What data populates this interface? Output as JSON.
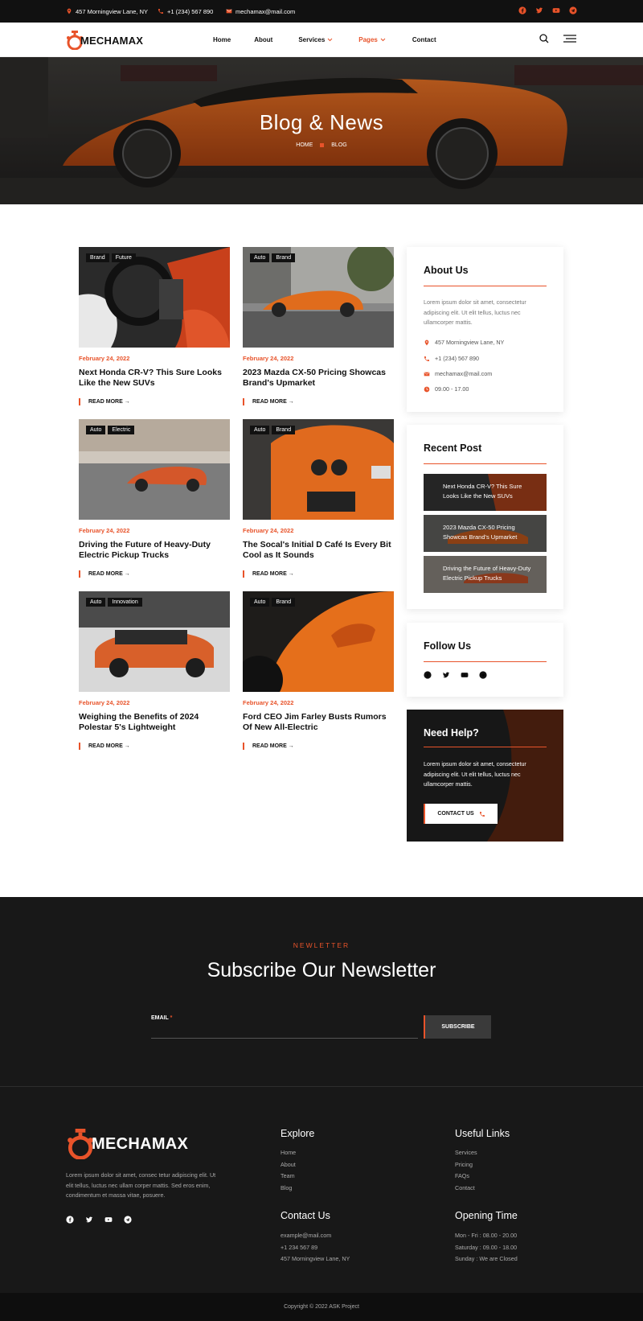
{
  "topbar": {
    "address": "457 Morningview Lane, NY",
    "phone": "+1 (234) 567 890",
    "email": "mechamax@mail.com"
  },
  "brand": {
    "name": "MECHAMAX"
  },
  "nav": {
    "items": [
      {
        "label": "Home"
      },
      {
        "label": "About"
      },
      {
        "label": "Services"
      },
      {
        "label": "Pages"
      },
      {
        "label": "Contact"
      }
    ]
  },
  "hero": {
    "title": "Blog & News",
    "crumb_home": "HOME",
    "crumb_current": "BLOG"
  },
  "posts": [
    {
      "tags": [
        "Brand",
        "Future"
      ],
      "date": "February 24, 2022",
      "title": "Next Honda CR-V? This Sure Looks Like the New SUVs",
      "more": "READ MORE"
    },
    {
      "tags": [
        "Auto",
        "Brand"
      ],
      "date": "February 24, 2022",
      "title": "2023 Mazda CX-50 Pricing Showcas Brand's Upmarket",
      "more": "READ MORE"
    },
    {
      "tags": [
        "Auto",
        "Electric"
      ],
      "date": "February 24, 2022",
      "title": "Driving the Future of Heavy-Duty Electric Pickup Trucks",
      "more": "READ MORE"
    },
    {
      "tags": [
        "Auto",
        "Brand"
      ],
      "date": "February 24, 2022",
      "title": "The Socal's Initial D Café Is Every Bit Cool as It Sounds",
      "more": "READ MORE"
    },
    {
      "tags": [
        "Auto",
        "Innovation"
      ],
      "date": "February 24, 2022",
      "title": "Weighing the Benefits of 2024 Polestar 5's Lightweight",
      "more": "READ MORE"
    },
    {
      "tags": [
        "Auto",
        "Brand"
      ],
      "date": "February 24, 2022",
      "title": "Ford CEO Jim Farley Busts Rumors Of New All-Electric",
      "more": "READ MORE"
    }
  ],
  "sidebar": {
    "about": {
      "title": "About Us",
      "text": "Lorem ipsum dolor sit amet, consectetur adipiscing elit. Ut elit tellus, luctus nec ullamcorper mattis.",
      "address": "457 Morningview Lane, NY",
      "phone": "+1 (234) 567 890",
      "email": "mechamax@mail.com",
      "hours": "09.00 - 17.00"
    },
    "recent": {
      "title": "Recent Post",
      "items": [
        "Next Honda CR-V? This Sure Looks Like the New SUVs",
        "2023 Mazda CX-50 Pricing Showcas Brand's Upmarket",
        "Driving the Future of Heavy-Duty Electric Pickup Trucks"
      ]
    },
    "follow": {
      "title": "Follow Us"
    },
    "help": {
      "title": "Need Help?",
      "text": "Lorem ipsum dolor sit amet, consectetur adipiscing elit. Ut elit tellus, luctus nec ullamcorper mattis.",
      "button": "CONTACT US"
    }
  },
  "newsletter": {
    "label": "NEWLETTER",
    "title": "Subscribe Our Newsletter",
    "email_label": "EMAIL",
    "required_mark": "*",
    "button": "SUBSCRIBE"
  },
  "footer": {
    "about": "Lorem ipsum dolor sit amet, consec tetur adipiscing elit. Ut elit tellus, luctus nec ullam corper mattis. Sed eros enim, condimentum et massa vitae, posuere.",
    "explore": {
      "title": "Explore",
      "links": [
        "Home",
        "About",
        "Team",
        "Blog"
      ]
    },
    "useful": {
      "title": "Useful Links",
      "links": [
        "Services",
        "Pricing",
        "FAQs",
        "Contact"
      ]
    },
    "contact": {
      "title": "Contact Us",
      "lines": [
        "example@mail.com",
        "+1 234 567 89",
        "457 Morningview Lane, NY"
      ]
    },
    "hours": {
      "title": "Opening Time",
      "lines": [
        "Mon - Fri : 08.00 - 20.00",
        "Saturday : 09.00 - 18.00",
        "Sunday : We are Closed"
      ]
    },
    "copyright": "Copyright © 2022 ASK Project"
  },
  "colors": {
    "accent": "#e8532a",
    "dark": "#181818",
    "topbar": "#111111"
  },
  "icons": [
    "map-pin-icon",
    "phone-icon",
    "envelope-icon",
    "clock-icon",
    "facebook-icon",
    "twitter-icon",
    "youtube-icon",
    "telegram-icon",
    "search-icon",
    "menu-icon",
    "chevron-down-icon",
    "arrow-right-icon"
  ]
}
